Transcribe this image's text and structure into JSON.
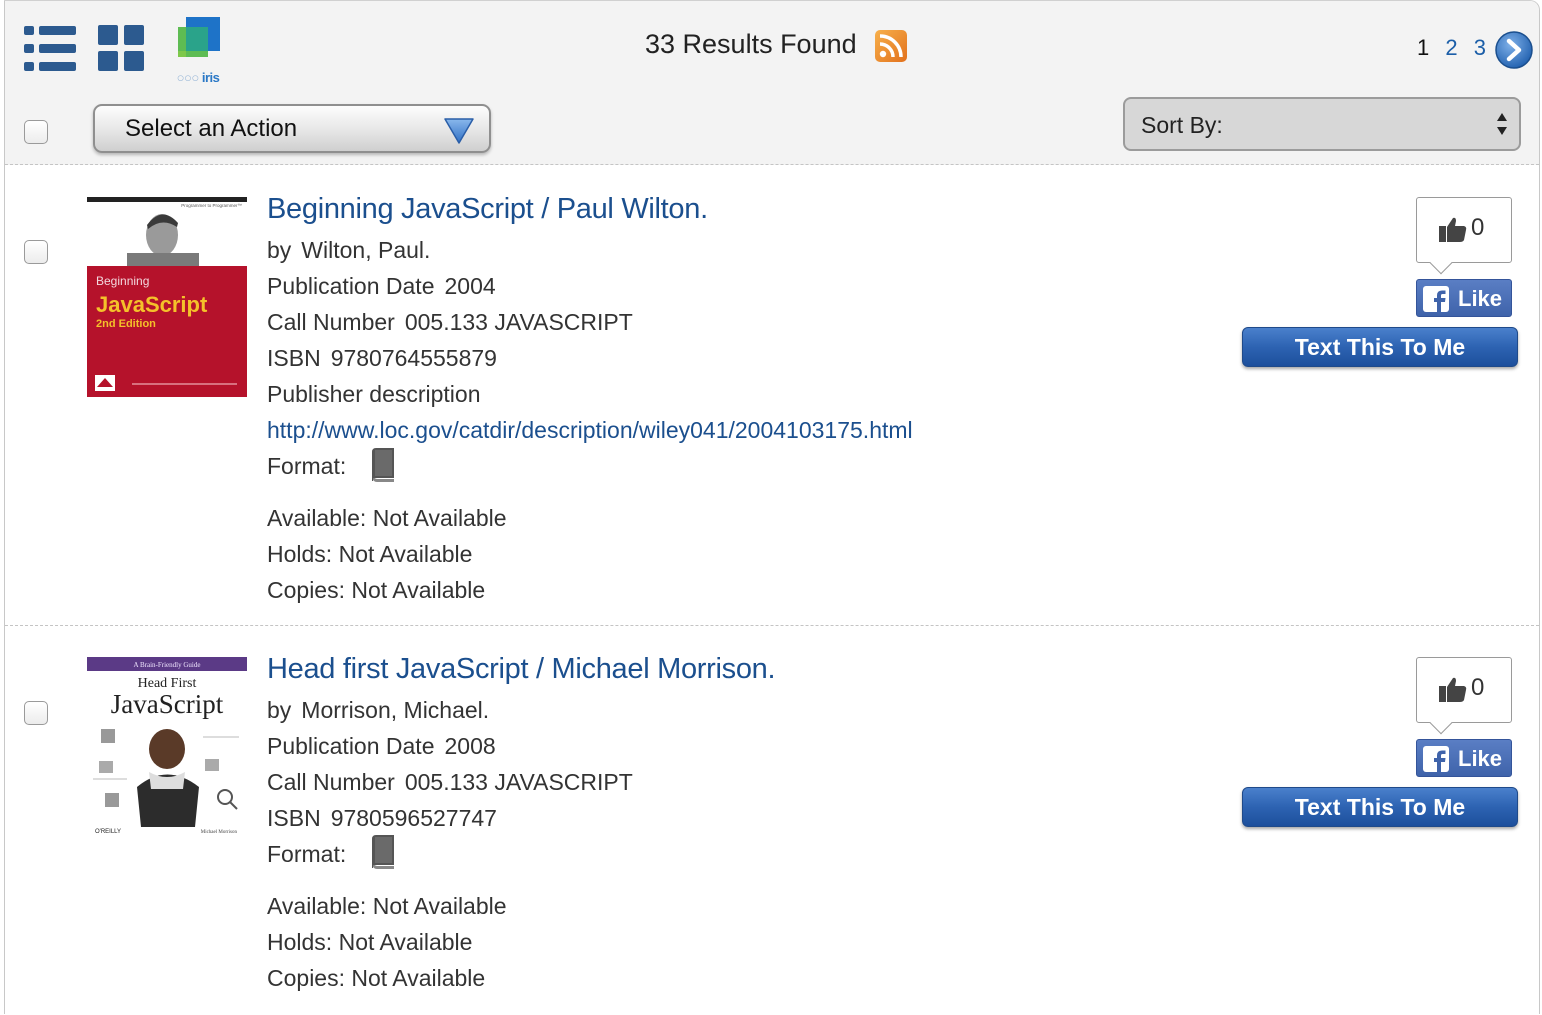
{
  "toolbar": {
    "results_label": "33 Results Found",
    "iris_logo_text": "iris",
    "pagination": {
      "current": "1",
      "pages": [
        "2",
        "3"
      ]
    },
    "action_select": {
      "label": "Select an Action"
    },
    "sort_select": {
      "label": "Sort By:"
    }
  },
  "records": [
    {
      "title": "Beginning JavaScript / Paul Wilton.",
      "by_label": "by",
      "author": "Wilton, Paul.",
      "pub_date_label": "Publication Date",
      "pub_date": "2004",
      "call_number_label": "Call Number",
      "call_number": "005.133 JAVASCRIPT",
      "isbn_label": "ISBN",
      "isbn": "9780764555879",
      "publisher_desc": "Publisher description",
      "url": "http://www.loc.gov/catdir/description/wiley041/2004103175.html",
      "format_label": "Format:",
      "available_label": "Available:",
      "available": "Not Available",
      "holds_label": "Holds:",
      "holds": "Not Available",
      "copies_label": "Copies:",
      "copies": "Not Available",
      "like_count": "0",
      "like_label": "Like",
      "text_me_label": "Text This To Me",
      "cover": {
        "tagline": "Programmer to Programmer™",
        "line1": "Beginning",
        "line2": "JavaScript",
        "line3": "2nd Edition",
        "publisher": "WROX"
      }
    },
    {
      "title": "Head first JavaScript / Michael Morrison.",
      "by_label": "by",
      "author": "Morrison, Michael.",
      "pub_date_label": "Publication Date",
      "pub_date": "2008",
      "call_number_label": "Call Number",
      "call_number": "005.133 JAVASCRIPT",
      "isbn_label": "ISBN",
      "isbn": "9780596527747",
      "format_label": "Format:",
      "available_label": "Available:",
      "available": "Not Available",
      "holds_label": "Holds:",
      "holds": "Not Available",
      "copies_label": "Copies:",
      "copies": "Not Available",
      "like_count": "0",
      "like_label": "Like",
      "text_me_label": "Text This To Me",
      "cover": {
        "tagline": "A Brain-Friendly Guide",
        "line1": "Head First",
        "line2": "JavaScript",
        "publisher": "O'REILLY",
        "author": "Michael Morrison"
      }
    }
  ],
  "colors": {
    "link_blue": "#1b4f8e",
    "button_blue": "#2d63b2",
    "facebook_blue": "#3f63aa",
    "cover_red": "#b5122b",
    "cover_purple": "#5b3a86"
  },
  "icons": [
    "list-view-icon",
    "grid-view-icon",
    "iris-logo",
    "rss-icon",
    "next-page-icon",
    "dropdown-arrow-icon",
    "sort-arrows-icon",
    "book-icon",
    "thumbs-up-icon",
    "facebook-f-icon"
  ]
}
